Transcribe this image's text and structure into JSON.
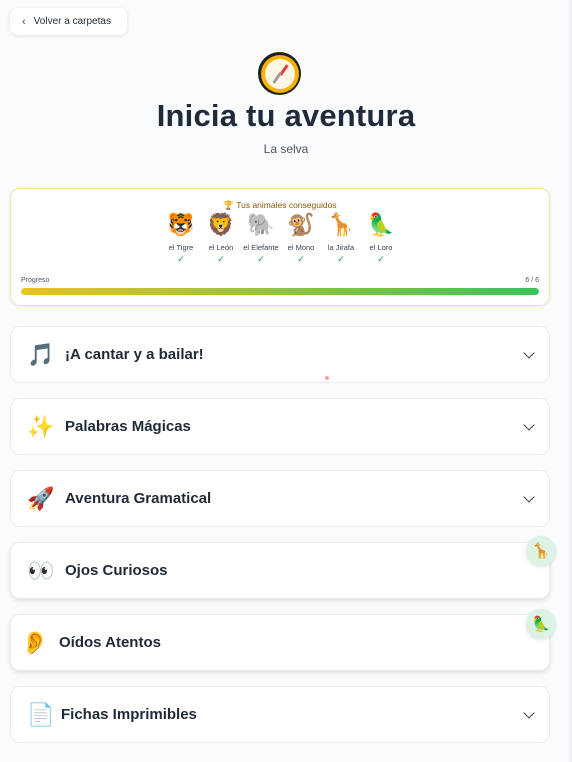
{
  "back_button": {
    "label": "Volver a carpetas",
    "icon": "chevron-left-icon"
  },
  "header": {
    "icon": "compass-icon",
    "title": "Inicia tu aventura",
    "subtitle": "La selva"
  },
  "animals_card": {
    "title": "Tus animales conseguidos",
    "title_icon": "trophy-icon",
    "animals": [
      {
        "emoji": "🐯",
        "name": "el Tigre",
        "check": "✓"
      },
      {
        "emoji": "🦁",
        "name": "el León",
        "check": "✓"
      },
      {
        "emoji": "🐘",
        "name": "el Elefante",
        "check": "✓"
      },
      {
        "emoji": "🐒",
        "name": "el Mono",
        "check": "✓"
      },
      {
        "emoji": "🦒",
        "name": "la Jirafa",
        "check": "✓"
      },
      {
        "emoji": "🦜",
        "name": "el Loro",
        "check": "✓"
      }
    ],
    "progress_label": "Progreso",
    "progress_count": "6 / 6",
    "progress_fraction": 1.0
  },
  "sections": [
    {
      "emoji": "🎵",
      "label": "¡A cantar y a bailar!",
      "expandable": true
    },
    {
      "emoji": "✨",
      "label": "Palabras Mágicas",
      "expandable": true
    },
    {
      "emoji": "🚀",
      "label": "Aventura Gramatical",
      "expandable": true
    },
    {
      "emoji": "👀",
      "label": "Ojos Curiosos",
      "expandable": false,
      "badge": "🦒"
    },
    {
      "emoji": "👂",
      "label": "Oídos Atentos",
      "expandable": false,
      "badge": "🦜"
    },
    {
      "emoji": "📄",
      "label": "Fichas Imprimibles",
      "expandable": true
    }
  ],
  "colors": {
    "progress_start": "#e8c31e",
    "progress_end": "#3cc25b",
    "badge_bg": "#dcf3e3",
    "card_border": "#f2e3a7"
  }
}
